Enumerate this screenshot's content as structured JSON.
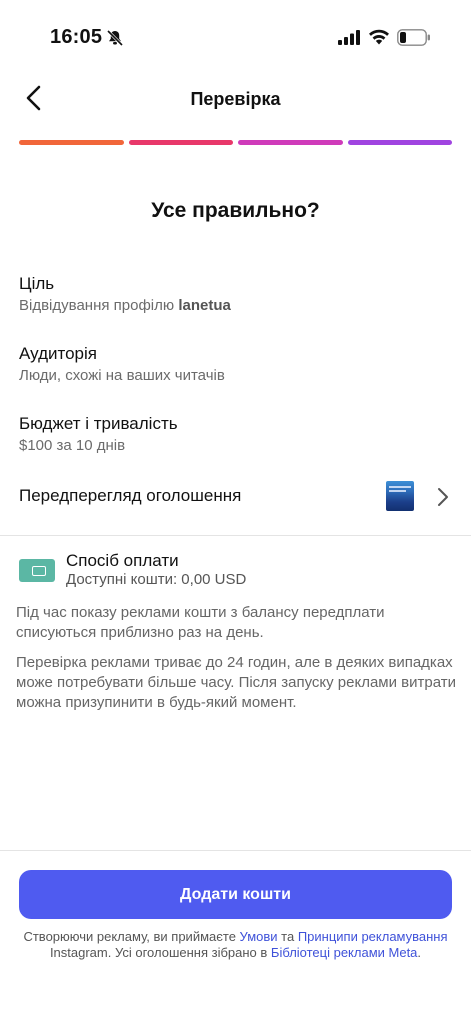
{
  "status_bar": {
    "time": "16:05"
  },
  "header": {
    "title": "Перевірка"
  },
  "progress_colors": [
    "#f1663a",
    "#e8386a",
    "#cf3bba",
    "#a044e0"
  ],
  "heading": "Усе правильно?",
  "sections": {
    "goal": {
      "label": "Ціль",
      "value_prefix": "Відвідування профілю",
      "value_bold": "lanetua"
    },
    "audience": {
      "label": "Аудиторія",
      "value": "Люди, схожі на ваших читачів"
    },
    "budget": {
      "label": "Бюджет і тривалість",
      "value": "$100 за 10 днів"
    },
    "preview": {
      "label": "Передперегляд оголошення"
    }
  },
  "payment": {
    "title": "Спосіб оплати",
    "available": "Доступні кошти: 0,00 USD"
  },
  "info": {
    "para1": "Під час показу реклами кошти з балансу передплати списуються приблизно раз на день.",
    "para2": "Перевірка реклами триває до 24 годин, але в деяких випадках може потребувати більше часу. Після запуску реклами витрати можна призупинити в будь-який момент."
  },
  "cta": {
    "label": "Додати кошти"
  },
  "legal": {
    "t1": "Створюючи рекламу, ви приймаєте ",
    "link1": "Умови",
    "t2": " та ",
    "link2": "Принципи рекламування",
    "t3": " Instagram. Усі оголошення зібрано в ",
    "link3": "Бібліотеці реклами Meta",
    "t4": "."
  },
  "icons": {
    "back": "chevron-left-icon",
    "silent": "bell-slash-icon",
    "signal": "cellular-signal-icon",
    "wifi": "wifi-icon",
    "battery": "battery-icon",
    "wallet": "wallet-icon",
    "chevron": "chevron-right-icon"
  },
  "colors": {
    "accent": "#4f5bf0",
    "link": "#3f52d9",
    "wallet": "#5bb7a4"
  }
}
